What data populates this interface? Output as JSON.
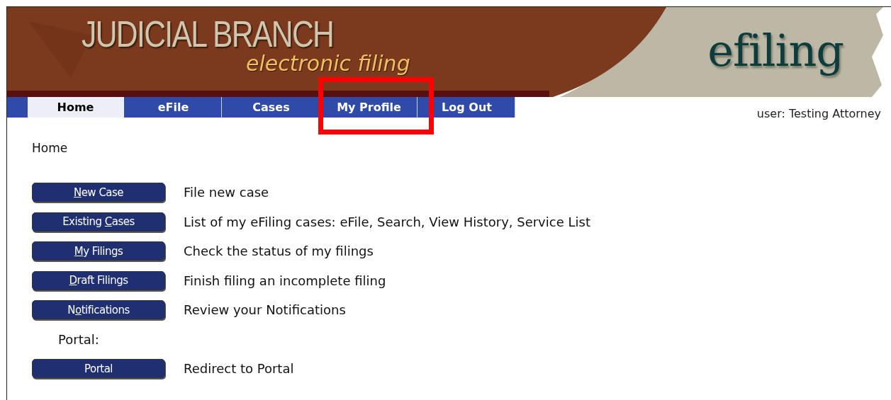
{
  "header": {
    "title": "JUDICIAL BRANCH",
    "subtitle": "electronic filing",
    "logo_text": "efiling"
  },
  "tabs": [
    {
      "label": "Home",
      "selected": true
    },
    {
      "label": "eFile",
      "selected": false
    },
    {
      "label": "Cases",
      "selected": false
    },
    {
      "label": "My Profile",
      "selected": false,
      "highlighted": true
    },
    {
      "label": "Log Out",
      "selected": false
    }
  ],
  "user": "user: Testing Attorney",
  "breadcrumb": "Home",
  "rows": [
    {
      "kind": "action",
      "button": {
        "key": "N",
        "after": "ew Case"
      },
      "description": "File new case"
    },
    {
      "kind": "action",
      "button": {
        "before": "Existing ",
        "key": "C",
        "after": "ases"
      },
      "description": "List of my eFiling cases: eFile, Search, View History, Service List"
    },
    {
      "kind": "action",
      "button": {
        "key": "M",
        "after": "y Filings"
      },
      "description": "Check the status of my filings"
    },
    {
      "kind": "action",
      "button": {
        "key": "D",
        "after": "raft Filings"
      },
      "description": "Finish filing an incomplete filing"
    },
    {
      "kind": "action",
      "button": {
        "before": "N",
        "key": "o",
        "after": "tifications"
      },
      "description": "Review your Notifications"
    },
    {
      "kind": "section",
      "label": "Portal:"
    },
    {
      "kind": "action",
      "button": {
        "before": "Portal"
      },
      "description": "Redirect to Portal"
    }
  ]
}
